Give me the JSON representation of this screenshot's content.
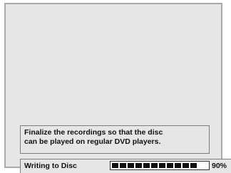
{
  "message": {
    "line1": "Finalize the recordings so that the disc",
    "line2": "can be played on regular DVD players."
  },
  "status": {
    "label": "Writing to Disc",
    "progress_percent_text": "90%",
    "progress_fraction": 0.9
  }
}
